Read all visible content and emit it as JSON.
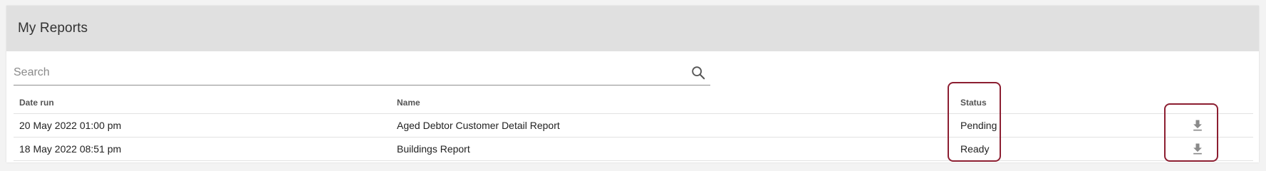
{
  "page": {
    "title": "My Reports"
  },
  "search": {
    "placeholder": "Search",
    "value": "",
    "icon": "search-icon"
  },
  "table": {
    "columns": {
      "date_run": "Date run",
      "name": "Name",
      "status": "Status"
    },
    "rows": [
      {
        "date_run": "20 May 2022 01:00 pm",
        "name": "Aged Debtor Customer Detail Report",
        "status": "Pending",
        "action_icon": "download-icon"
      },
      {
        "date_run": "18 May 2022 08:51 pm",
        "name": "Buildings Report",
        "status": "Ready",
        "action_icon": "download-icon"
      }
    ]
  },
  "colors": {
    "header_bg": "#e0e0e0",
    "highlight": "#8c1e31",
    "icon": "#8a8a8a"
  }
}
